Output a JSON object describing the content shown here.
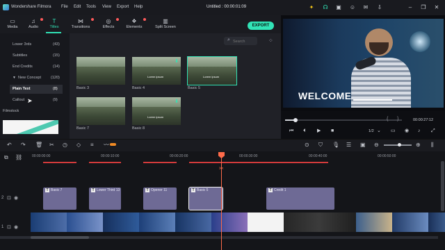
{
  "titlebar": {
    "app_name": "Wondershare Filmora",
    "menus": [
      "File",
      "Edit",
      "Tools",
      "View",
      "Export",
      "Help"
    ],
    "doc_title": "Untitled : 00:00:01:09",
    "icons": [
      "lightbulb-icon",
      "headset-icon",
      "gift-icon",
      "user-icon",
      "mail-icon",
      "download-icon",
      "minimize-icon",
      "restore-icon",
      "close-icon"
    ]
  },
  "toolbar": {
    "tools": [
      {
        "label": "Media",
        "icon": "folder-icon"
      },
      {
        "label": "Audio",
        "icon": "music-icon"
      },
      {
        "label": "Titles",
        "icon": "text-icon"
      },
      {
        "label": "Transitions",
        "icon": "transition-icon"
      },
      {
        "label": "Effects",
        "icon": "effects-icon"
      },
      {
        "label": "Elements",
        "icon": "elements-icon"
      },
      {
        "label": "Split Screen",
        "icon": "split-icon"
      }
    ],
    "active": "Titles",
    "export_label": "EXPORT",
    "accent": "#31e3b6"
  },
  "left_panel": {
    "categories": [
      {
        "label": "Lower 3rds",
        "count": "(43)"
      },
      {
        "label": "Subtitles",
        "count": "(15)"
      },
      {
        "label": "End Credits",
        "count": "(14)"
      },
      {
        "label": "New Concept",
        "count": "(120)"
      },
      {
        "label": "Plain Text",
        "count": "(8)"
      },
      {
        "label": "Callout",
        "count": "(9)"
      }
    ],
    "selected": "Plain Text",
    "filmstock_label": "Filmstock"
  },
  "media": {
    "search_placeholder": "Search",
    "items": [
      {
        "label": "Basic 3",
        "caption": ""
      },
      {
        "label": "Basic 4",
        "caption": "Lorem ipsum"
      },
      {
        "label": "Basic 5",
        "caption": "Lorem ipsum"
      },
      {
        "label": "Basic 7",
        "caption": ""
      },
      {
        "label": "Basic 8",
        "caption": "Lorem ipsum"
      }
    ],
    "selected": "Basic 5"
  },
  "preview": {
    "overlay_text": "WELCOME",
    "timecode": "00:00:27:12",
    "ratio": "1/2",
    "brackets": [
      "{",
      "}"
    ],
    "progress": 0.09
  },
  "timeline": {
    "ruler": [
      "00:00:00:00",
      "00:00:10:00",
      "00:00:20:00",
      "00:00:30:00",
      "00:00:40:00",
      "00:00:50:00"
    ],
    "title_clips": [
      {
        "label": "Basic 7",
        "selected": false
      },
      {
        "label": "Lower Third 13",
        "selected": false
      },
      {
        "label": "Opener 11",
        "selected": false
      },
      {
        "label": "Basic 5",
        "selected": true
      },
      {
        "label": "Credit 1",
        "selected": false
      }
    ],
    "track_badges": [
      "2",
      "1"
    ],
    "playhead_color": "#ff6b4a",
    "clip_color": "#6e6a95"
  }
}
